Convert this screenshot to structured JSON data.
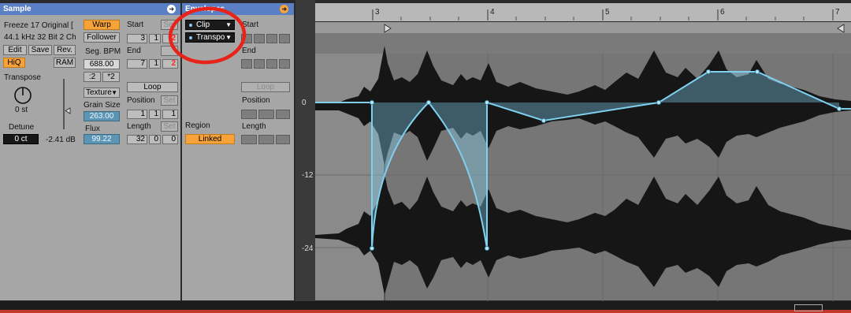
{
  "sample_panel": {
    "title": "Sample",
    "name": "Freeze 17 Original [",
    "info": "44.1 kHz 32 Bit 2 Ch",
    "edit": "Edit",
    "save": "Save",
    "rev": "Rev.",
    "hiq": "HiQ",
    "ram": "RAM",
    "transpose_label": "Transpose",
    "transpose_value": "0 st",
    "detune_label": "Detune",
    "detune_value": "0 ct",
    "gain_value": "-2.41 dB",
    "warp": "Warp",
    "follower": "Follower",
    "seg_bpm_label": "Seg. BPM",
    "seg_bpm_value": "688.00",
    "half": ":2",
    "double": "*2",
    "mode": "Texture",
    "grain_size_label": "Grain Size",
    "grain_size_value": "263.00",
    "flux_label": "Flux",
    "flux_value": "99.22",
    "start_label": "Start",
    "start_set": "Set",
    "start_vals": [
      "3",
      "1",
      "2"
    ],
    "end_label": "End",
    "end_vals": [
      "7",
      "1",
      "2"
    ],
    "loop": "Loop",
    "position_label": "Position",
    "position_set": "Set",
    "position_vals": [
      "1",
      "1",
      "1"
    ],
    "length_label": "Length",
    "length_set": "Set",
    "length_vals": [
      "32",
      "0",
      "0"
    ]
  },
  "envelopes_panel": {
    "title": "Envelopes",
    "device_select": "Clip",
    "control_select": "Transpo",
    "region_label": "Region",
    "region_value": "Linked",
    "start_label": "Start",
    "end_label": "End",
    "loop": "Loop",
    "position_label": "Position",
    "length_label": "Length"
  },
  "editor": {
    "ruler": [
      "3",
      "4",
      "5",
      "6",
      "7"
    ],
    "db_labels": [
      "0",
      "-12",
      "-24"
    ]
  },
  "colors": {
    "accent_orange": "#f7a33a",
    "envelope_blue": "#7fd0ee",
    "header_blue": "#5b7fc4",
    "annotation_red": "#e8231a"
  }
}
